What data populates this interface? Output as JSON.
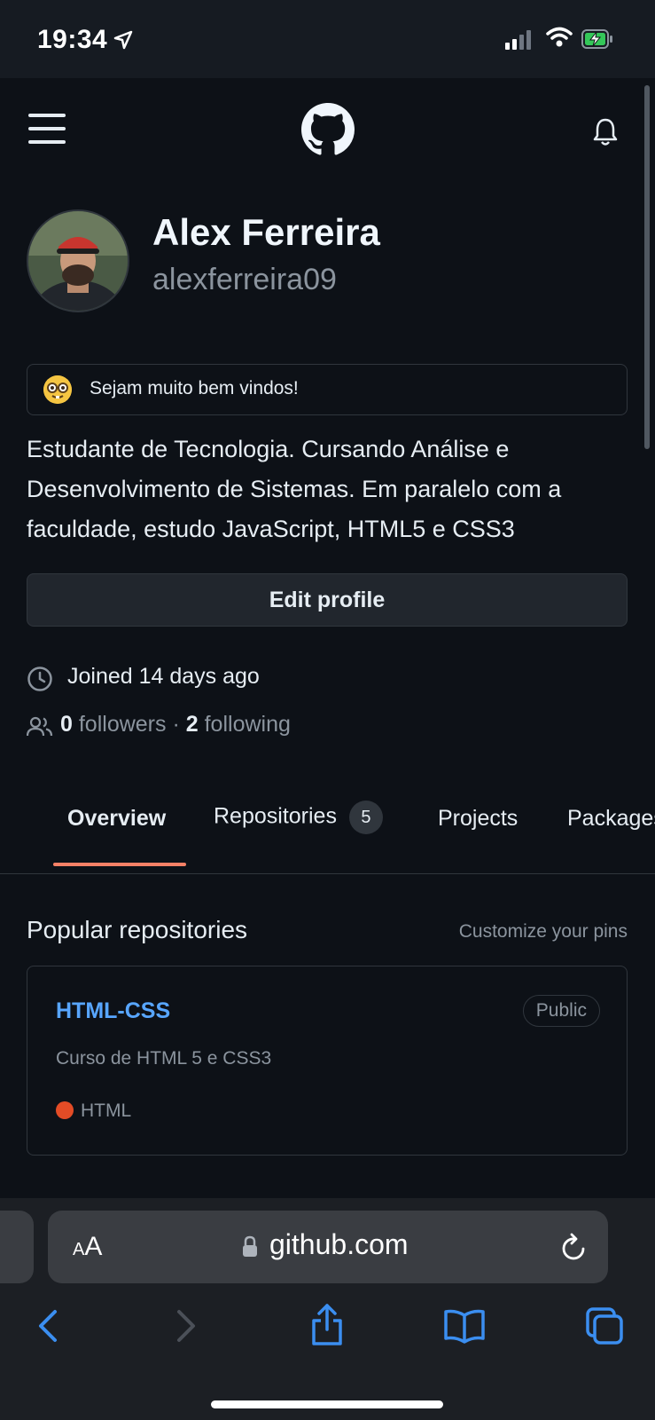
{
  "status_bar": {
    "time": "19:34"
  },
  "header": {
    "logo": "github-mark-icon"
  },
  "profile": {
    "name": "Alex Ferreira",
    "login": "alexferreira09",
    "status_emoji": "nerd-face-emoji",
    "status_text": "Sejam muito bem vindos!",
    "bio": "Estudante de Tecnologia. Cursando Análise e Desenvolvimento de Sistemas. Em paralelo com a faculdade, estudo JavaScript, HTML5 e CSS3",
    "edit_label": "Edit profile",
    "joined": "Joined 14 days ago",
    "followers_count": "0",
    "followers_label": "followers",
    "separator": "·",
    "following_count": "2",
    "following_label": "following"
  },
  "tabs": [
    {
      "label": "Overview",
      "active": true
    },
    {
      "label": "Repositories",
      "counter": "5"
    },
    {
      "label": "Projects"
    },
    {
      "label": "Packages"
    }
  ],
  "popular": {
    "title": "Popular repositories",
    "customize": "Customize your pins",
    "repos": [
      {
        "name": "HTML-CSS",
        "visibility": "Public",
        "description": "Curso de HTML 5 e CSS3",
        "language": "HTML",
        "language_color": "#e34c26"
      }
    ]
  },
  "browser": {
    "aa_small": "A",
    "aa_big": "A",
    "url": "github.com"
  },
  "colors": {
    "background": "#0d1117",
    "link": "#58a6ff",
    "tab_underline": "#f78166"
  }
}
